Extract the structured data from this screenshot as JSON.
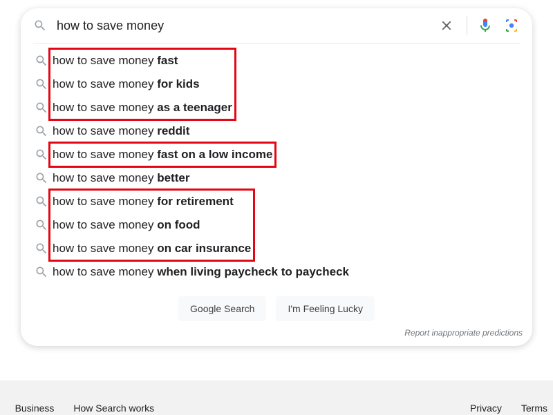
{
  "search": {
    "value": "how to save money ",
    "placeholder": ""
  },
  "suggestions": [
    {
      "prefix": "how to save money ",
      "bold": "fast"
    },
    {
      "prefix": "how to save money ",
      "bold": "for kids"
    },
    {
      "prefix": "how to save money ",
      "bold": "as a teenager"
    },
    {
      "prefix": "how to save money ",
      "bold": "reddit"
    },
    {
      "prefix": "how to save money ",
      "bold": "fast on a low income"
    },
    {
      "prefix": "how to save money ",
      "bold": "better"
    },
    {
      "prefix": "how to save money ",
      "bold": "for retirement"
    },
    {
      "prefix": "how to save money ",
      "bold": "on food"
    },
    {
      "prefix": "how to save money ",
      "bold": "on car insurance"
    },
    {
      "prefix": "how to save money ",
      "bold": "when living paycheck to paycheck"
    }
  ],
  "buttons": {
    "search": "Google Search",
    "lucky": "I'm Feeling Lucky"
  },
  "report_label": "Report inappropriate predictions",
  "footer": {
    "left": [
      "Business",
      "How Search works"
    ],
    "right": [
      "Privacy",
      "Terms"
    ]
  },
  "icons": {
    "search": "search-icon",
    "clear": "close-icon",
    "mic": "mic-icon",
    "lens": "lens-icon"
  },
  "highlight_groups": [
    {
      "start": 0,
      "end": 2
    },
    {
      "start": 4,
      "end": 4
    },
    {
      "start": 6,
      "end": 8
    }
  ]
}
